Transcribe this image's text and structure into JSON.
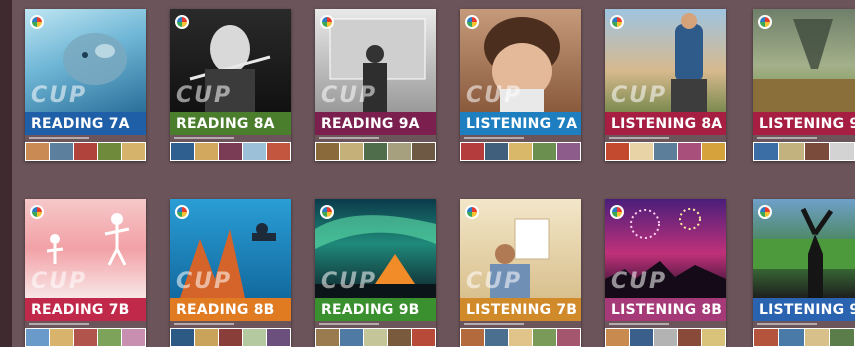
{
  "brand": "CUP",
  "colors": {
    "background": "#6b545a",
    "reading_7": "#1f5fa8",
    "reading_8": "#4a7d2c",
    "reading_9": "#7b1f4f",
    "listening_7": "#1e7fc0",
    "listening_8": "#a61f43",
    "listening_9": "#2d8a3f",
    "reading_7b_band": "#c0294a",
    "reading_8b_band": "#e07b22",
    "reading_9b_band": "#3a8f2e",
    "listening_7b_band": "#d18a2a",
    "listening_8b_band": "#a63a78",
    "listening_9b_band": "#2a63b0"
  },
  "books": [
    {
      "title": "READING 7A",
      "icon": "dolphin-image"
    },
    {
      "title": "READING 8A",
      "icon": "violinist-image"
    },
    {
      "title": "READING 9A",
      "icon": "person-at-screen-image"
    },
    {
      "title": "LISTENING 7A",
      "icon": "child-portrait-image"
    },
    {
      "title": "LISTENING 8A",
      "icon": "hiker-backpack-image"
    },
    {
      "title": "LISTENING 9",
      "icon": "tornado-field-image"
    },
    {
      "title": "READING 7B",
      "icon": "kids-jumping-image"
    },
    {
      "title": "READING 8B",
      "icon": "coral-reef-diver-image"
    },
    {
      "title": "READING 9B",
      "icon": "aurora-tent-image"
    },
    {
      "title": "LISTENING 7B",
      "icon": "child-reading-image"
    },
    {
      "title": "LISTENING 8B",
      "icon": "fireworks-crowd-image"
    },
    {
      "title": "LISTENING 9",
      "icon": "stadium-fans-image"
    }
  ]
}
